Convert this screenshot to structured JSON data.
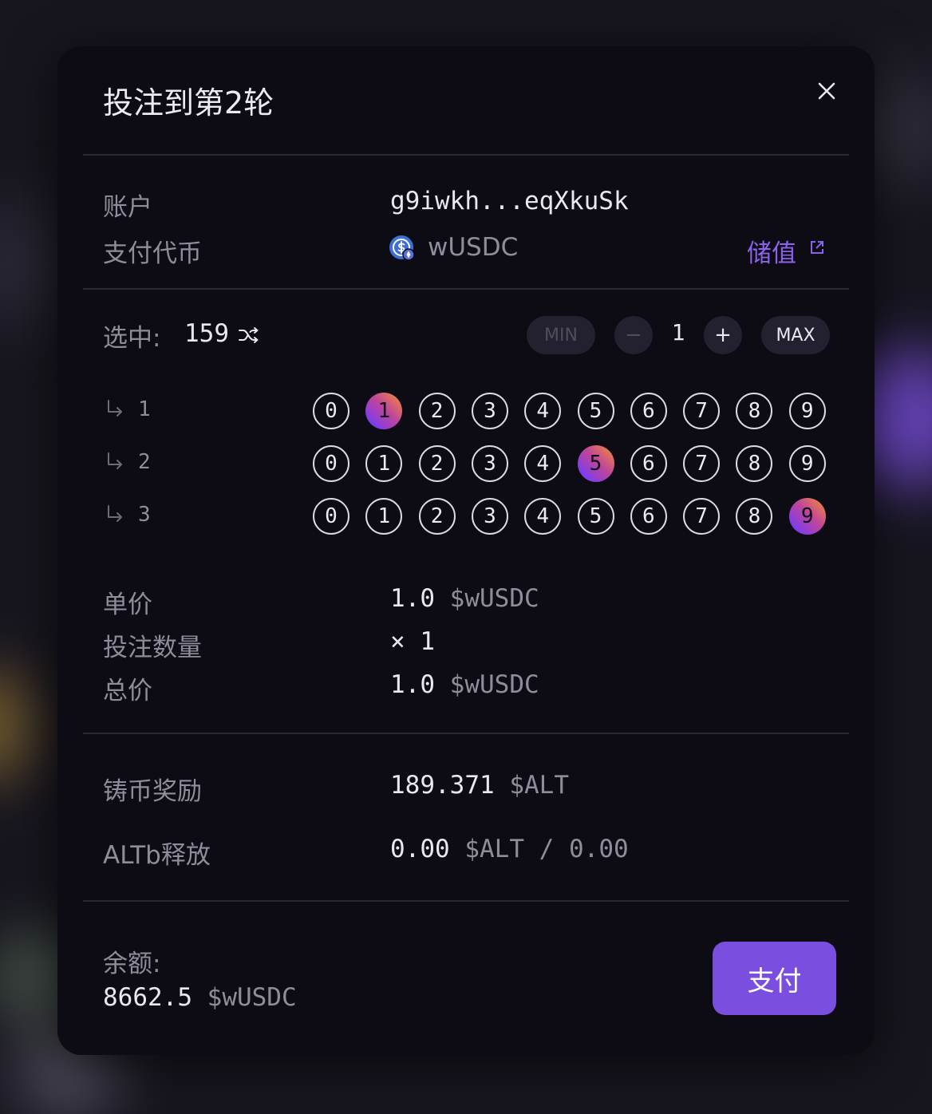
{
  "modal": {
    "title": "投注到第2轮",
    "close_icon": "close-icon"
  },
  "account": {
    "label": "账户",
    "value": "g9iwkh...eqXkuSk"
  },
  "pay_token": {
    "label": "支付代币",
    "icon": "usdc-token-icon",
    "name": "wUSDC",
    "recharge_label": "储值",
    "recharge_icon": "external-link-icon"
  },
  "selection": {
    "label": "选中:",
    "value": "159",
    "shuffle_icon": "shuffle-icon",
    "min_label": "MIN",
    "minus_label": "−",
    "quantity": "1",
    "plus_label": "+",
    "max_label": "MAX"
  },
  "digit_rows": [
    {
      "label": "1",
      "digits": [
        "0",
        "1",
        "2",
        "3",
        "4",
        "5",
        "6",
        "7",
        "8",
        "9"
      ],
      "selected": 1
    },
    {
      "label": "2",
      "digits": [
        "0",
        "1",
        "2",
        "3",
        "4",
        "5",
        "6",
        "7",
        "8",
        "9"
      ],
      "selected": 5
    },
    {
      "label": "3",
      "digits": [
        "0",
        "1",
        "2",
        "3",
        "4",
        "5",
        "6",
        "7",
        "8",
        "9"
      ],
      "selected": 9
    }
  ],
  "pricing": {
    "unit_price_label": "单价",
    "unit_price_value": "1.0",
    "unit_price_unit": "$wUSDC",
    "bet_count_label": "投注数量",
    "bet_count_value": "× 1",
    "total_label": "总价",
    "total_value": "1.0",
    "total_unit": "$wUSDC"
  },
  "rewards": {
    "mint_label": "铸币奖励",
    "mint_value": "189.371",
    "mint_unit": "$ALT",
    "release_label": "ALTb释放",
    "release_value": "0.00",
    "release_unit": "$ALT",
    "release_sep": "/",
    "release_total": "0.00"
  },
  "footer": {
    "balance_label": "余额:",
    "balance_value": "8662.5",
    "balance_unit": "$wUSDC",
    "pay_label": "支付"
  },
  "colors": {
    "accent": "#7a4fe0",
    "modal_bg": "#0d0b14",
    "muted_text": "#8f8d99",
    "selected_gradient": [
      "#7b3cf0",
      "#c0459a",
      "#f0893c"
    ]
  }
}
